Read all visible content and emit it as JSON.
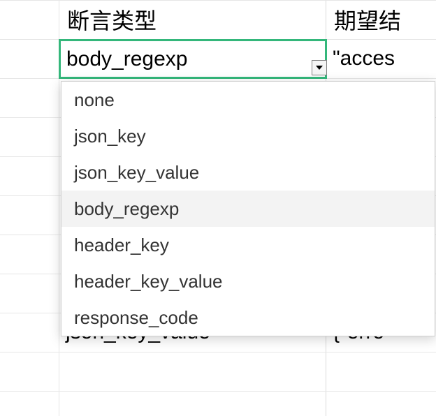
{
  "headers": {
    "assert_type": "断言类型",
    "expect": "期望结"
  },
  "active_cell": {
    "value": "body_regexp"
  },
  "right_cell": {
    "value": "\"acces"
  },
  "dropdown": {
    "options": [
      {
        "label": "none",
        "selected": false
      },
      {
        "label": "json_key",
        "selected": false
      },
      {
        "label": "json_key_value",
        "selected": false
      },
      {
        "label": "body_regexp",
        "selected": true
      },
      {
        "label": "header_key",
        "selected": false
      },
      {
        "label": "header_key_value",
        "selected": false
      },
      {
        "label": "response_code",
        "selected": false
      }
    ]
  },
  "bottom_row": {
    "left": "json_key_value",
    "right": "{\"erro"
  }
}
